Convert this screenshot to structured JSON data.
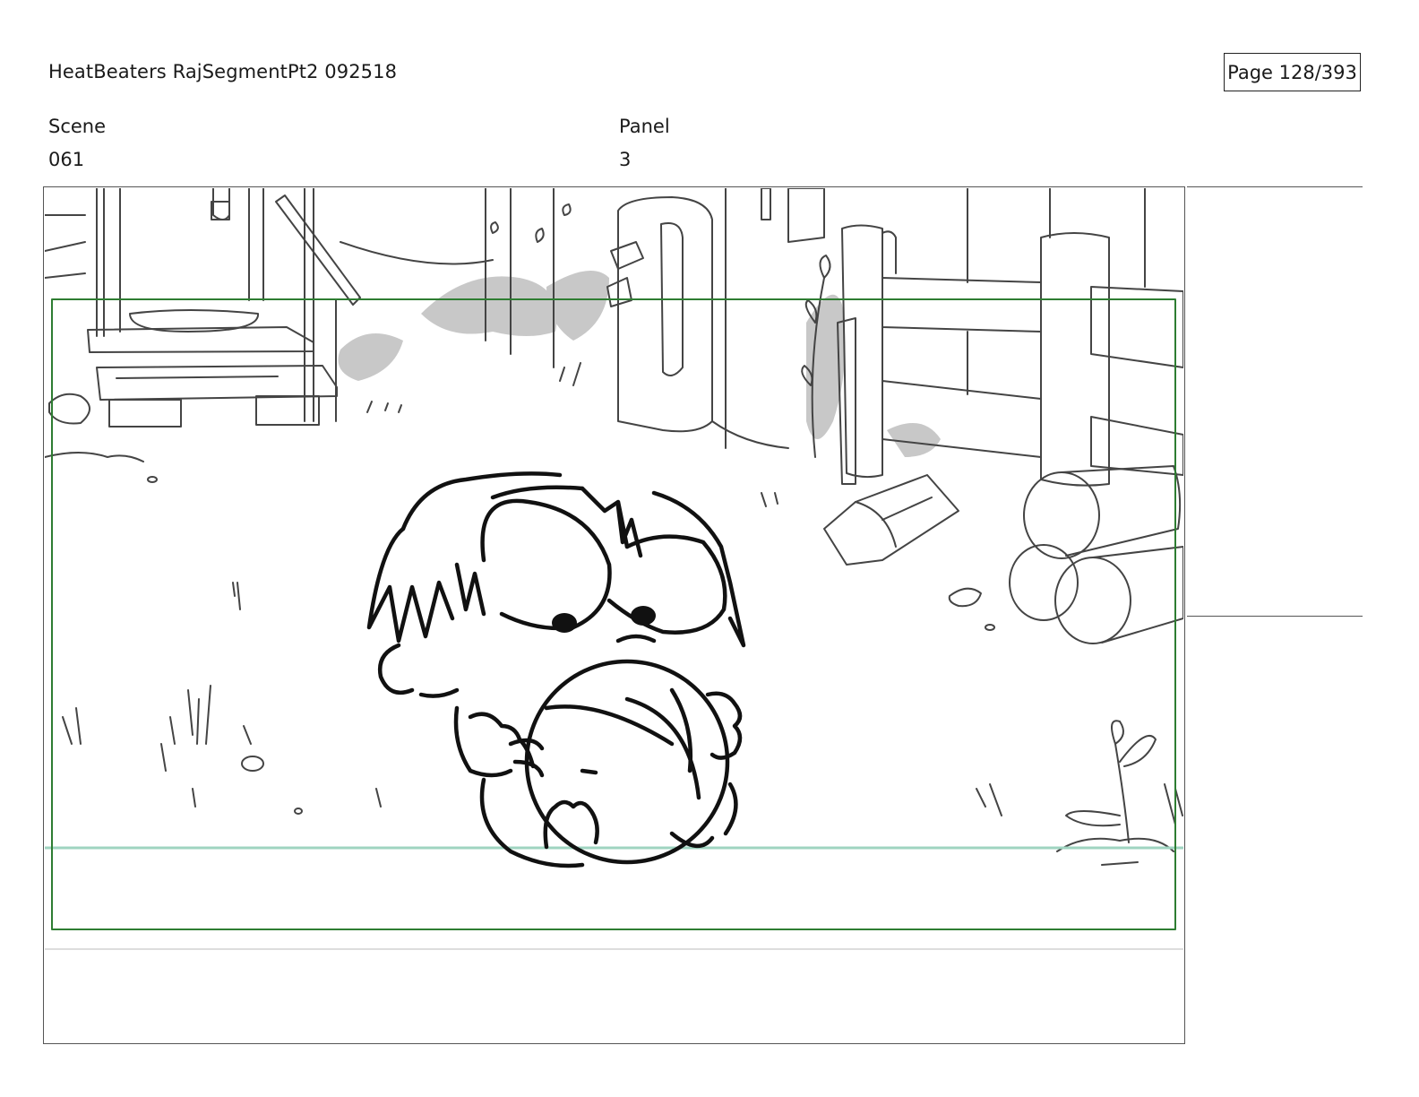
{
  "header": {
    "document_title": "HeatBeaters RajSegmentPt2 092518",
    "page_indicator": "Page 128/393"
  },
  "fields": {
    "scene_label": "Scene",
    "scene_value": "061",
    "panel_label": "Panel",
    "panel_value": "3"
  },
  "panel": {
    "safe_frame_color": "#2e7d32",
    "horizon_guide_color": "#9fd4c0",
    "sketch_line_color": "#111111",
    "background_line_color": "#444444",
    "shadow_tone_color": "#c8c8c8",
    "notes": ""
  }
}
